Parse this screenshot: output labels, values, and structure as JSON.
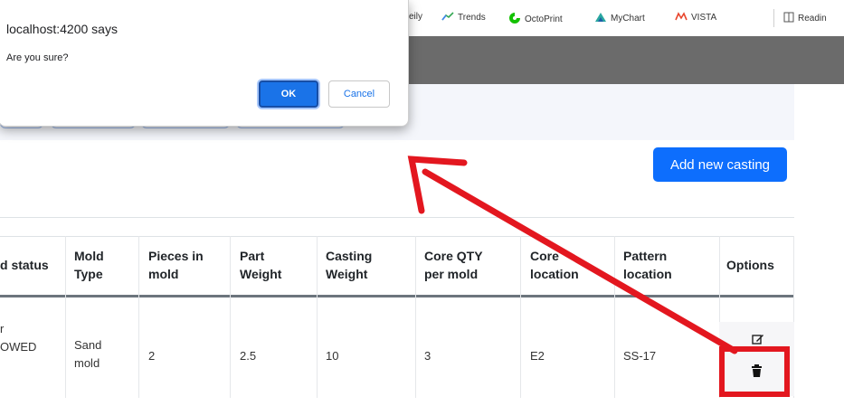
{
  "bookmarks": {
    "items": [
      {
        "label": "eily"
      },
      {
        "label": "Trends"
      },
      {
        "label": "OctoPrint"
      },
      {
        "label": "MyChart"
      },
      {
        "label": "VISTA"
      },
      {
        "label": "Readin"
      }
    ]
  },
  "main": {
    "add_button_label": "Add new casting",
    "table": {
      "headers": [
        [
          "d status"
        ],
        [
          "Mold",
          "Type"
        ],
        [
          "Pieces in",
          "mold"
        ],
        [
          "Part",
          "Weight"
        ],
        [
          "Casting",
          "Weight"
        ],
        [
          "Core QTY",
          "per mold"
        ],
        [
          "Core",
          "location"
        ],
        [
          "Pattern",
          "location"
        ],
        [
          "Options"
        ]
      ],
      "row": {
        "status_line1": "r",
        "status_line2": "OWED",
        "mold_type_line1": "Sand",
        "mold_type_line2": "mold",
        "pieces_in_mold": "2",
        "part_weight": "2.5",
        "casting_weight": "10",
        "core_qty_per_mold": "3",
        "core_location": "E2",
        "pattern_location": "SS-17"
      }
    }
  },
  "dialog": {
    "title": "localhost:4200 says",
    "message": "Are you sure?",
    "ok_label": "OK",
    "cancel_label": "Cancel"
  },
  "colors": {
    "primary": "#0d6efd",
    "dialog_ok": "#1a73e8",
    "annotation_red": "#e3171f",
    "header_band": "#6b6b6b"
  }
}
